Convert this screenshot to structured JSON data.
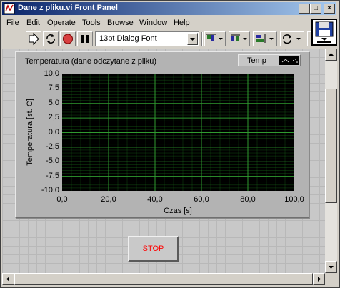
{
  "window": {
    "title": "Dane z pliku.vi Front Panel"
  },
  "menu": [
    {
      "label": "File",
      "mnemonic": "F"
    },
    {
      "label": "Edit",
      "mnemonic": "E"
    },
    {
      "label": "Operate",
      "mnemonic": "O"
    },
    {
      "label": "Tools",
      "mnemonic": "T"
    },
    {
      "label": "Browse",
      "mnemonic": "B"
    },
    {
      "label": "Window",
      "mnemonic": "W"
    },
    {
      "label": "Help",
      "mnemonic": "H"
    }
  ],
  "toolbar": {
    "font": "13pt Dialog Font"
  },
  "graph": {
    "title": "Temperatura (dane odczytane z pliku)",
    "legend_label": "Temp",
    "plot_bg": "#000000",
    "grid_color": "#1a6b1a"
  },
  "chart_data": {
    "type": "line",
    "title": "Temperatura (dane odczytane z pliku)",
    "xlabel": "Czas [s]",
    "ylabel": "Temperatura [st. C]",
    "xlim": [
      0,
      100
    ],
    "ylim": [
      -10,
      10
    ],
    "x_ticks": [
      "0,0",
      "20,0",
      "40,0",
      "60,0",
      "80,0",
      "100,0"
    ],
    "y_ticks": [
      "10,0",
      "7,5",
      "5,0",
      "2,5",
      "0,0",
      "-2,5",
      "-5,0",
      "-7,5",
      "-10,0"
    ],
    "grid": true,
    "series": [
      {
        "name": "Temp",
        "x": [],
        "y": []
      }
    ]
  },
  "stop_button": {
    "label": "STOP",
    "color": "#ff0000"
  }
}
